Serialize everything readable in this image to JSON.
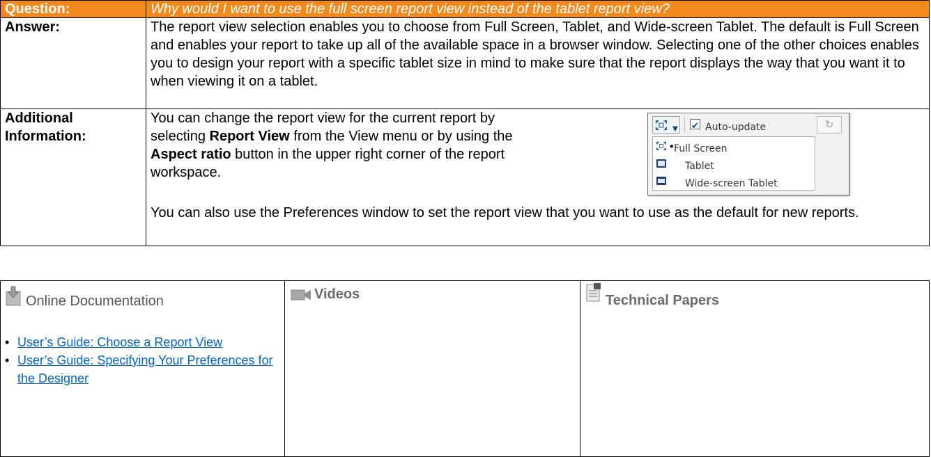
{
  "qa": {
    "question_label": "Question:",
    "question_text": "Why would I want to use the full screen report view instead of the tablet report view?",
    "answer_label": "Answer:",
    "answer_text": "The report view selection enables you to choose from Full Screen, Tablet, and Wide-screen Tablet. The default is Full Screen and enables your report to take up all of the available space in a browser window. Selecting one of the other choices enables you to design your report with a specific tablet size in mind to make sure that the report displays the way that you want it to when viewing it on a tablet.",
    "additional_label": "Additional Information:",
    "additional_p1_a": "You can change the report view for the current report by selecting ",
    "additional_p1_b1": "Report View",
    "additional_p1_c": " from the View menu or by using the ",
    "additional_p1_b2": "Aspect ratio",
    "additional_p1_d": " button in the upper right corner of the report workspace.",
    "additional_p2": "You can also use the Preferences window to set the report view that you want to use as the default for new reports."
  },
  "widget": {
    "auto_update_label": "Auto-update",
    "auto_update_checked": true,
    "menu_items": [
      {
        "label": "Full Screen",
        "selected": true,
        "icon": "full-screen-icon"
      },
      {
        "label": "Tablet",
        "selected": false,
        "icon": "tablet-icon"
      },
      {
        "label": "Wide-screen Tablet",
        "selected": false,
        "icon": "wide-screen-tablet-icon"
      }
    ]
  },
  "resources": {
    "online_doc_title": "Online Documentation",
    "videos_title": "Videos",
    "papers_title": "Technical Papers",
    "links": [
      {
        "text": "User’s Guide: Choose a Report View"
      },
      {
        "text": "User’s Guide: Specifying Your Preferences for the Designer"
      }
    ]
  },
  "colors": {
    "header_orange": "#f38a1e",
    "link_blue": "#0563c1"
  }
}
